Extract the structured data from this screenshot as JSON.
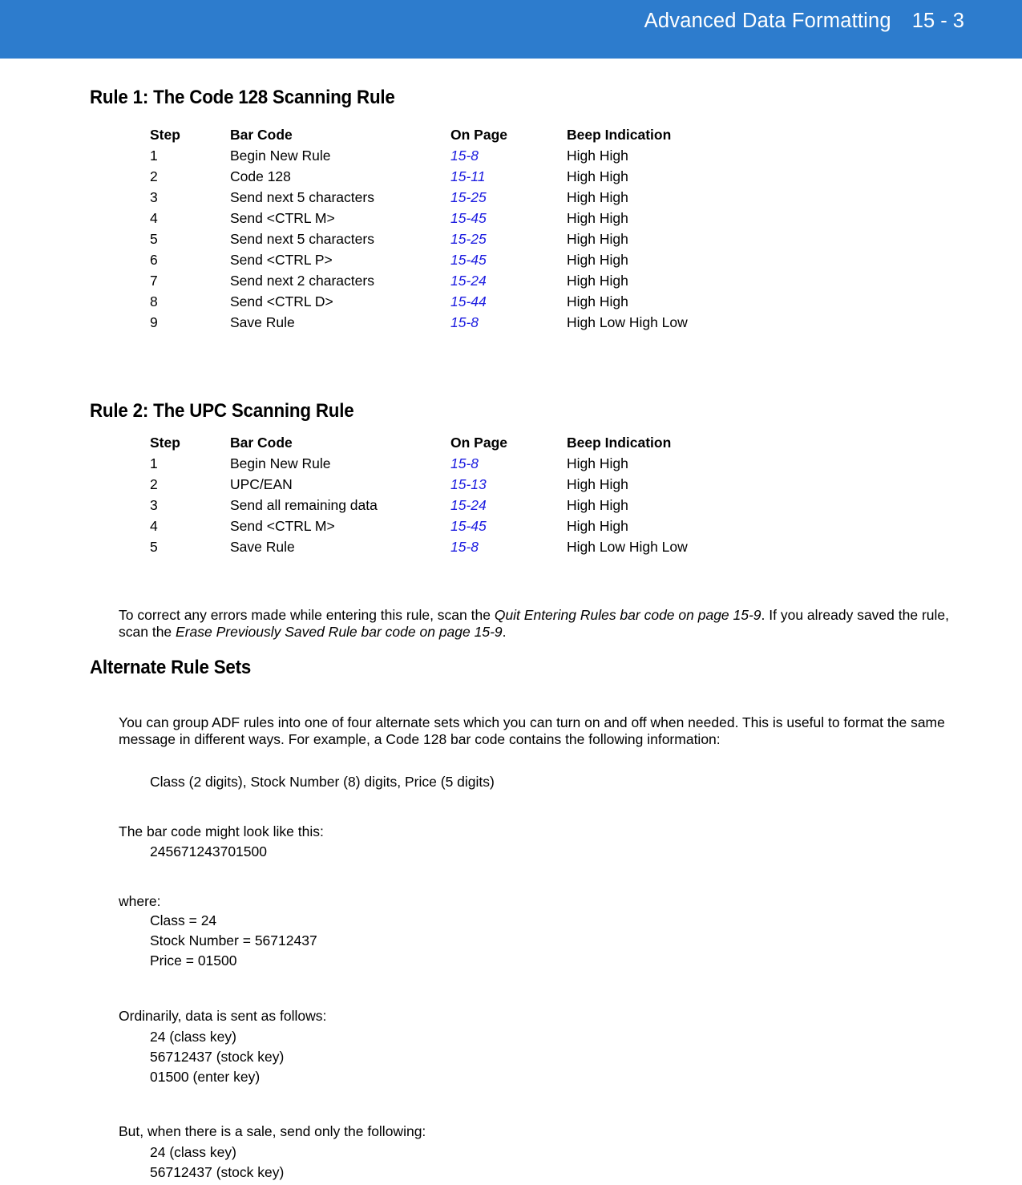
{
  "header": {
    "title": "Advanced Data Formatting",
    "page_number": "15 - 3",
    "band_color": "#2d7ccd",
    "text_color": "#ffffff"
  },
  "link_color": "#1c1ce0",
  "rule1": {
    "heading": "Rule 1: The Code 128 Scanning Rule",
    "columns": [
      "Step",
      "Bar Code",
      "On Page",
      "Beep Indication"
    ],
    "rows": [
      {
        "step": "1",
        "bar_code": "Begin New Rule",
        "on_page": "15-8",
        "beep": "High High"
      },
      {
        "step": "2",
        "bar_code": "Code 128",
        "on_page": "15-11",
        "beep": "High High"
      },
      {
        "step": "3",
        "bar_code": "Send next 5 characters",
        "on_page": "15-25",
        "beep": "High High"
      },
      {
        "step": "4",
        "bar_code": "Send <CTRL M>",
        "on_page": "15-45",
        "beep": "High High"
      },
      {
        "step": "5",
        "bar_code": "Send next 5 characters",
        "on_page": "15-25",
        "beep": "High High"
      },
      {
        "step": "6",
        "bar_code": "Send <CTRL P>",
        "on_page": "15-45",
        "beep": "High High"
      },
      {
        "step": "7",
        "bar_code": "Send next 2 characters",
        "on_page": "15-24",
        "beep": "High High"
      },
      {
        "step": "8",
        "bar_code": "Send <CTRL D>",
        "on_page": "15-44",
        "beep": "High High"
      },
      {
        "step": "9",
        "bar_code": "Save Rule",
        "on_page": "15-8",
        "beep": "High Low High Low"
      }
    ]
  },
  "rule2": {
    "heading": "Rule 2: The UPC Scanning Rule",
    "columns": [
      "Step",
      "Bar Code",
      "On Page",
      "Beep Indication"
    ],
    "rows": [
      {
        "step": "1",
        "bar_code": "Begin New Rule",
        "on_page": "15-8",
        "beep": "High High"
      },
      {
        "step": "2",
        "bar_code": "UPC/EAN",
        "on_page": "15-13",
        "beep": "High High"
      },
      {
        "step": "3",
        "bar_code": "Send all remaining data",
        "on_page": "15-24",
        "beep": "High High"
      },
      {
        "step": "4",
        "bar_code": "Send <CTRL M>",
        "on_page": "15-45",
        "beep": "High High"
      },
      {
        "step": "5",
        "bar_code": "Save Rule",
        "on_page": "15-8",
        "beep": "High Low High Low"
      }
    ]
  },
  "correction_note": {
    "part1": "To correct any errors made while entering this rule, scan the ",
    "italic1": "Quit Entering Rules bar code on page 15-9",
    "part2": ". If you already saved the rule, scan the ",
    "italic2": "Erase Previously Saved Rule bar code on page 15-9",
    "part3": "."
  },
  "alternate": {
    "heading": "Alternate Rule Sets",
    "intro": "You can group ADF rules into one of four alternate sets which you can turn on and off when needed. This is useful to format the same message in different ways. For example, a Code 128 bar code contains the following information:",
    "format_line": "Class (2 digits), Stock Number (8) digits, Price (5 digits)",
    "might_look": "The bar code might look like this:",
    "barcode_value": "245671243701500",
    "where_label": "where:",
    "where_lines": [
      "Class = 24",
      "Stock Number = 56712437",
      "Price = 01500"
    ],
    "ordinarily": "Ordinarily, data is sent as follows:",
    "ordinarily_lines": [
      "24 (class key)",
      "56712437 (stock key)",
      "01500 (enter key)"
    ],
    "sale_intro": "But, when there is a sale, send only the following:",
    "sale_lines": [
      "24 (class key)",
      "56712437 (stock key)"
    ]
  }
}
